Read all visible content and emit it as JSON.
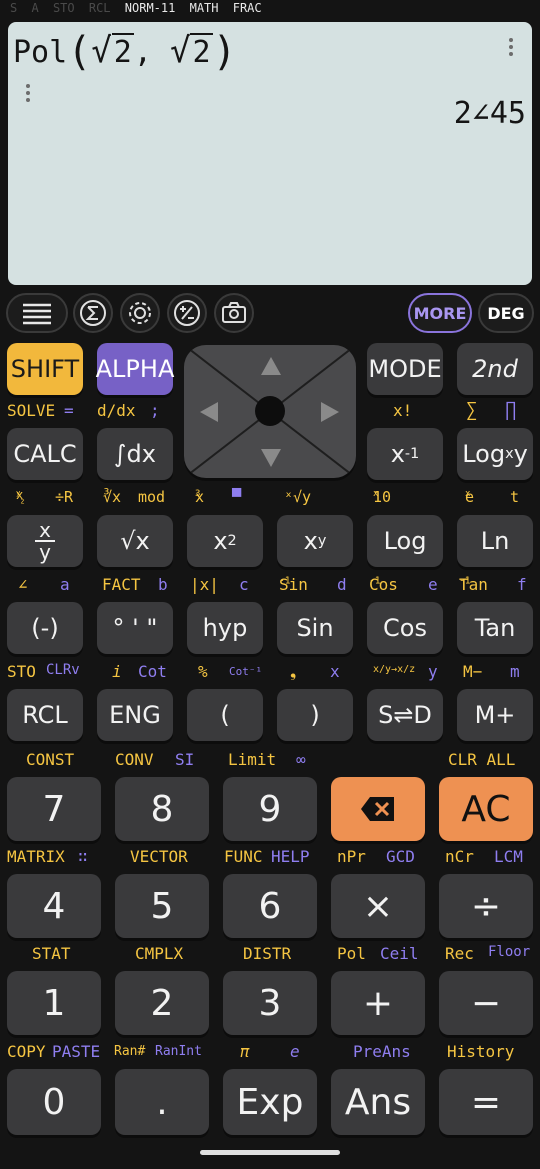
{
  "status": {
    "dim": [
      "S",
      "A",
      "STO",
      "RCL"
    ],
    "on": [
      "NORM-11",
      "MATH",
      "FRAC"
    ]
  },
  "display": {
    "expr_func": "Pol",
    "expr_open": "(",
    "expr_radicand_1": "2",
    "expr_comma": ",",
    "expr_radicand_2": "2",
    "expr_close": ")",
    "result": "2∠45"
  },
  "toolbar": {
    "more": "MORE",
    "deg": "DEG"
  },
  "keys": {
    "shift": "SHIFT",
    "alpha": "ALPHA",
    "mode": "MODE",
    "second": "2nd",
    "calc": "CALC",
    "integral": "∫dx",
    "inverse_base": "x",
    "inverse_exp": "-1",
    "logxy": "Log",
    "logxy_sub": "x",
    "logxy_y": "y",
    "frac_num": "x",
    "frac_den": "y",
    "sqrt": "√x",
    "square": "x",
    "square_exp": "2",
    "power": "x",
    "power_exp": "y",
    "log": "Log",
    "ln": "Ln",
    "neg": "(-)",
    "dms": "° ' \"",
    "hyp": "hyp",
    "sin": "Sin",
    "cos": "Cos",
    "tan": "Tan",
    "rcl": "RCL",
    "eng": "ENG",
    "lparen": "(",
    "rparen": ")",
    "sd": "S⇌D",
    "mplus": "M+",
    "n7": "7",
    "n8": "8",
    "n9": "9",
    "del": "⌫",
    "ac": "AC",
    "n4": "4",
    "n5": "5",
    "n6": "6",
    "mul": "×",
    "div": "÷",
    "n1": "1",
    "n2": "2",
    "n3": "3",
    "plus": "+",
    "minus": "−",
    "n0": "0",
    "dot": ".",
    "exp": "Exp",
    "ans": "Ans",
    "eq": "="
  },
  "labels": {
    "row1": {
      "solve": "SOLVE",
      "eq_sym": "=",
      "ddx": "d/dx",
      "semi": ";",
      "fact_excl": "x!",
      "sigma": "∑",
      "pi_prod": "∏"
    },
    "row2": {
      "xyz": "x",
      "xyz_sup": "y",
      "xyz_sub": "z",
      "divr": "÷R",
      "cbrt": "∛x",
      "mod": "mod",
      "cube": "x",
      "cube_exp": "3",
      "bar": "▀",
      "xroot": "ˣ√y",
      "ten": "10",
      "ten_exp": "x",
      "ex": "e",
      "ex_exp": "x",
      "t": "t"
    },
    "row3": {
      "angle": "∠",
      "a": "a",
      "fact": "FACT",
      "b": "b",
      "abs": "|x|",
      "c": "c",
      "asin": "Sin",
      "asin_exp": "-1",
      "d": "d",
      "acos": "Cos",
      "acos_exp": "-1",
      "e": "e",
      "atan": "Tan",
      "atan_exp": "-1",
      "f": "f"
    },
    "row4": {
      "sto": "STO",
      "clrv": "CLRv",
      "i": "i",
      "cot": "Cot",
      "pct": "%",
      "acot": "Cot⁻¹",
      "comma": "❟",
      "x": "x",
      "conv": "x/y→x/z",
      "y": "y",
      "mminus": "M−",
      "m": "m"
    },
    "row5": {
      "const": "CONST",
      "conv": "CONV",
      "si": "SI",
      "limit": "Limit",
      "inf": "∞",
      "clrall": "CLR ALL"
    },
    "row6": {
      "matrix": "MATRIX",
      "matrix_icon": "∷",
      "vector": "VECTOR",
      "func": "FUNC",
      "help": "HELP",
      "npr": "nPr",
      "gcd": "GCD",
      "ncr": "nCr",
      "lcm": "LCM"
    },
    "row7": {
      "stat": "STAT",
      "cmplx": "CMPLX",
      "distr": "DISTR",
      "pol": "Pol",
      "ceil": "Ceil",
      "rec": "Rec",
      "floor": "Floor"
    },
    "row8": {
      "copy": "COPY",
      "paste": "PASTE",
      "ranhash": "Ran#",
      "ranint": "RanInt",
      "pi": "π",
      "e": "e",
      "preans": "PreAns",
      "history": "History"
    }
  },
  "colors": {
    "shift": "#f2b83c",
    "alpha": "#7761c6",
    "accent_orange": "#ee9152",
    "display": "#d5e1e1",
    "key": "#3a3a3c"
  }
}
